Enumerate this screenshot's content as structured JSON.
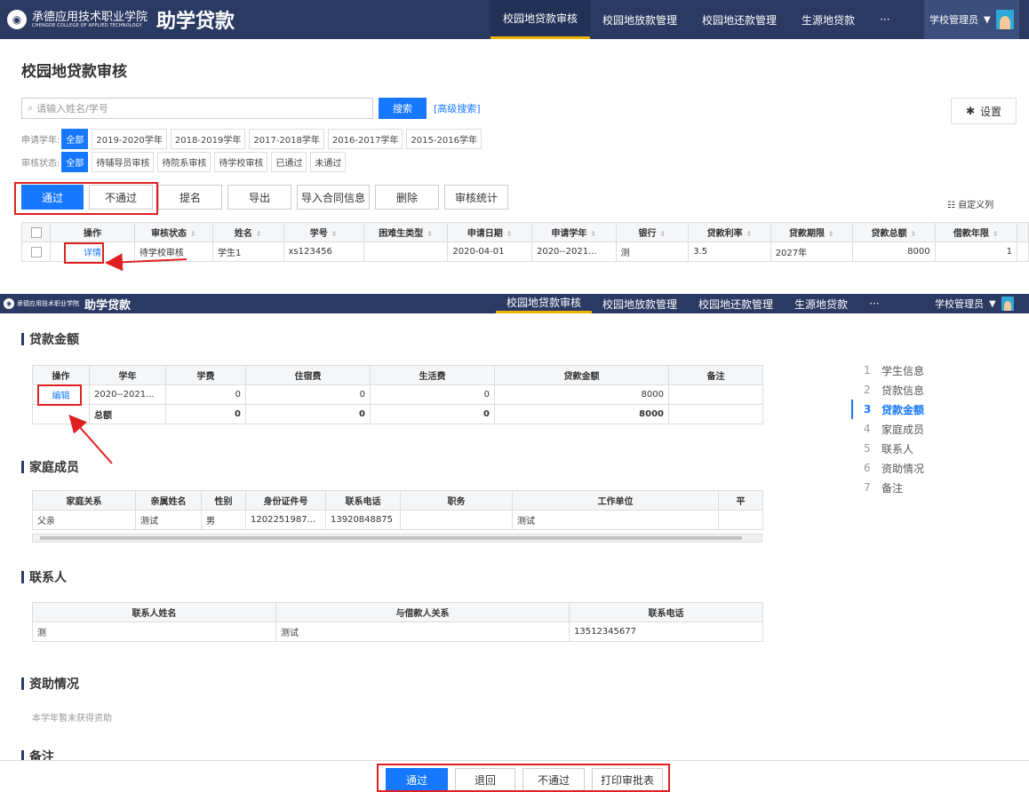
{
  "header": {
    "school_cn": "承德应用技术职业学院",
    "school_en": "CHENGDE COLLEGE OF APPLIED TECHNOLOGY",
    "app_title": "助学贷款",
    "nav": [
      "校园地贷款审核",
      "校园地放款管理",
      "校园地还款管理",
      "生源地贷款",
      "···"
    ],
    "user": "学校管理员"
  },
  "list": {
    "page_title": "校园地贷款审核",
    "search_placeholder": "请输入姓名/学号",
    "search_label": "搜索",
    "advanced_search": "[高级搜索]",
    "settings_label": "设置",
    "year_filter": {
      "label": "申请学年:",
      "options": [
        "全部",
        "2019-2020学年",
        "2018-2019学年",
        "2017-2018学年",
        "2016-2017学年",
        "2015-2016学年"
      ]
    },
    "status_filter": {
      "label": "审核状态:",
      "options": [
        "全部",
        "待辅导员审核",
        "待院系审核",
        "待学校审核",
        "已通过",
        "未通过"
      ]
    },
    "actions": [
      "通过",
      "不通过",
      "提名",
      "导出",
      "导入合同信息",
      "删除",
      "审核统计"
    ],
    "custom_columns": "自定义列",
    "columns": [
      "操作",
      "审核状态",
      "姓名",
      "学号",
      "困难生类型",
      "申请日期",
      "申请学年",
      "银行",
      "贷款利率",
      "贷款期限",
      "贷款总额",
      "借款年限"
    ],
    "row": {
      "op": "详情",
      "status": "待学校审核",
      "name": "学生1",
      "student_id": "xs123456",
      "difficulty": "",
      "date": "2020-04-01",
      "year": "2020--2021...",
      "bank": "测",
      "rate": "3.5",
      "term": "2027年",
      "total": "8000",
      "years": "1"
    }
  },
  "detail": {
    "loan_section": "贷款金额",
    "loan_columns": [
      "操作",
      "学年",
      "学费",
      "住宿费",
      "生活费",
      "贷款金额",
      "备注"
    ],
    "loan_row": {
      "op": "编辑",
      "year": "2020--2021...",
      "tuition": "0",
      "lodging": "0",
      "living": "0",
      "amount": "8000",
      "note": ""
    },
    "loan_total": {
      "label": "总额",
      "tuition": "0",
      "lodging": "0",
      "living": "0",
      "amount": "8000"
    },
    "family_section": "家庭成员",
    "family_columns": [
      "家庭关系",
      "亲属姓名",
      "性别",
      "身份证件号",
      "联系电话",
      "职务",
      "工作单位",
      "平"
    ],
    "family_row": {
      "relation": "父亲",
      "name": "测试",
      "gender": "男",
      "id": "1202251987...",
      "phone": "13920848875",
      "position": "",
      "employer": "测试",
      "extra": ""
    },
    "contact_section": "联系人",
    "contact_columns": [
      "联系人姓名",
      "与借款人关系",
      "联系电话"
    ],
    "contact_row": {
      "name": "测",
      "relation": "测试",
      "phone": "13512345677"
    },
    "aid_section": "资助情况",
    "aid_note": "本学年暂未获得资助",
    "notes_section": "备注",
    "side_nav": [
      {
        "num": "1",
        "label": "学生信息"
      },
      {
        "num": "2",
        "label": "贷款信息"
      },
      {
        "num": "3",
        "label": "贷款金额"
      },
      {
        "num": "4",
        "label": "家庭成员"
      },
      {
        "num": "5",
        "label": "联系人"
      },
      {
        "num": "6",
        "label": "资助情况"
      },
      {
        "num": "7",
        "label": "备注"
      }
    ],
    "footer_buttons": [
      "通过",
      "退回",
      "不通过",
      "打印审批表"
    ]
  },
  "colors": {
    "header_bg": "#2b3a63",
    "accent": "#1677ff",
    "nav_active": "#f2b300",
    "highlight": "#e02020"
  }
}
